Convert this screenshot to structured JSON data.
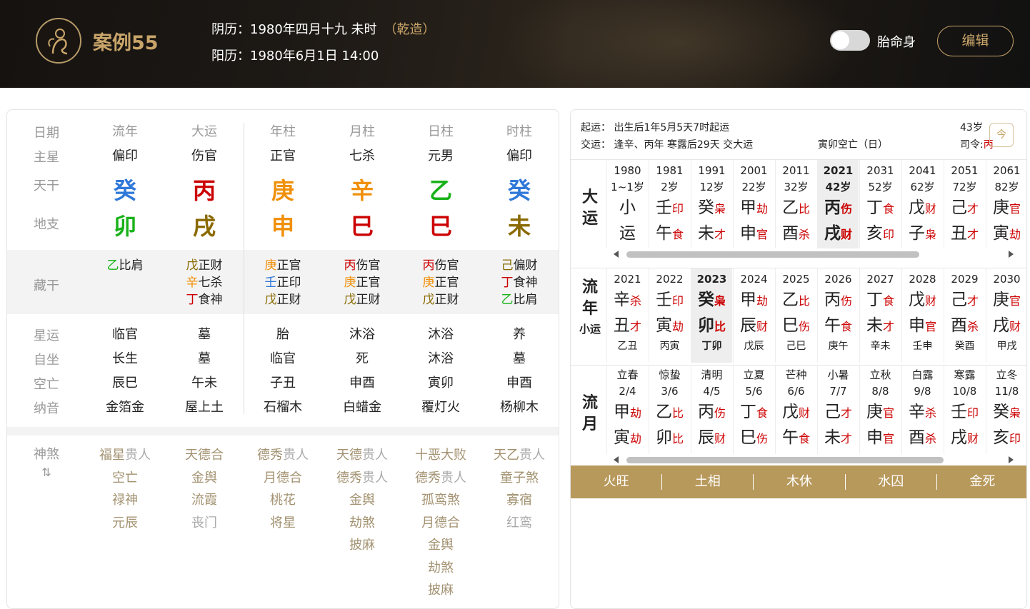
{
  "header": {
    "case_title": "案例55",
    "lunar_label": "阴历：1980年四月十九 未时",
    "lunar_tag": "（乾造）",
    "solar_label": "阳历：1980年6月1日 14:00",
    "toggle_label": "胎命身",
    "toggle_on": false,
    "edit_label": "编辑"
  },
  "colors": {
    "gold": "#c9a56a",
    "fire": "#cc0000",
    "wood": "#19b219",
    "water": "#2f78d9",
    "metal": "#f0900a",
    "earth": "#8a6a00"
  },
  "chart": {
    "row_labels": [
      "日期",
      "主星",
      "天干",
      "地支",
      "藏干",
      "星运",
      "自坐",
      "空亡",
      "纳音",
      "神煞"
    ],
    "shensha_toggle": "⇅",
    "columns": [
      {
        "header": "流年",
        "star": "偏印",
        "stem": "癸",
        "stem_color": "#2f78d9",
        "branch": "卯",
        "branch_color": "#19b219",
        "hidden": [
          {
            "s": "乙",
            "c": "#19b219",
            "g": "比肩"
          }
        ],
        "xingyun": "临官",
        "zizuo": "长生",
        "kongwang": "辰巳",
        "nayin": "金箔金",
        "shensha": [
          [
            "福星",
            "贵人"
          ],
          [
            "空亡",
            ""
          ],
          [
            "禄神",
            ""
          ],
          [
            "元辰",
            ""
          ]
        ]
      },
      {
        "header": "大运",
        "star": "伤官",
        "stem": "丙",
        "stem_color": "#cc0000",
        "branch": "戌",
        "branch_color": "#8a6a00",
        "hidden": [
          {
            "s": "戊",
            "c": "#8a6a00",
            "g": "正财"
          },
          {
            "s": "辛",
            "c": "#f0900a",
            "g": "七杀"
          },
          {
            "s": "丁",
            "c": "#cc0000",
            "g": "食神"
          }
        ],
        "xingyun": "墓",
        "zizuo": "墓",
        "kongwang": "午未",
        "nayin": "屋上土",
        "shensha": [
          [
            "天德合",
            ""
          ],
          [
            "金舆",
            ""
          ],
          [
            "流霞",
            ""
          ],
          [
            "",
            "丧门"
          ]
        ]
      },
      {
        "header": "年柱",
        "star": "正官",
        "stem": "庚",
        "stem_color": "#f0900a",
        "branch": "申",
        "branch_color": "#f0900a",
        "hidden": [
          {
            "s": "庚",
            "c": "#f0900a",
            "g": "正官"
          },
          {
            "s": "壬",
            "c": "#2f78d9",
            "g": "正印"
          },
          {
            "s": "戊",
            "c": "#8a6a00",
            "g": "正财"
          }
        ],
        "xingyun": "胎",
        "zizuo": "临官",
        "kongwang": "子丑",
        "nayin": "石榴木",
        "shensha": [
          [
            "德秀",
            "贵人"
          ],
          [
            "月德合",
            ""
          ],
          [
            "桃花",
            ""
          ],
          [
            "将星",
            ""
          ]
        ]
      },
      {
        "header": "月柱",
        "star": "七杀",
        "stem": "辛",
        "stem_color": "#f0900a",
        "branch": "巳",
        "branch_color": "#cc0000",
        "hidden": [
          {
            "s": "丙",
            "c": "#cc0000",
            "g": "伤官"
          },
          {
            "s": "庚",
            "c": "#f0900a",
            "g": "正官"
          },
          {
            "s": "戊",
            "c": "#8a6a00",
            "g": "正财"
          }
        ],
        "xingyun": "沐浴",
        "zizuo": "死",
        "kongwang": "申酉",
        "nayin": "白蜡金",
        "shensha": [
          [
            "天德",
            "贵人"
          ],
          [
            "德秀",
            "贵人"
          ],
          [
            "金舆",
            ""
          ],
          [
            "劫煞",
            ""
          ],
          [
            "披麻",
            ""
          ]
        ]
      },
      {
        "header": "日柱",
        "star": "元男",
        "stem": "乙",
        "stem_color": "#19b219",
        "branch": "巳",
        "branch_color": "#cc0000",
        "hidden": [
          {
            "s": "丙",
            "c": "#cc0000",
            "g": "伤官"
          },
          {
            "s": "庚",
            "c": "#f0900a",
            "g": "正官"
          },
          {
            "s": "戊",
            "c": "#8a6a00",
            "g": "正财"
          }
        ],
        "xingyun": "沐浴",
        "zizuo": "沐浴",
        "kongwang": "寅卯",
        "nayin": "覆灯火",
        "shensha": [
          [
            "十恶大败",
            ""
          ],
          [
            "德秀",
            "贵人"
          ],
          [
            "孤鸾煞",
            ""
          ],
          [
            "月德合",
            ""
          ],
          [
            "金舆",
            ""
          ],
          [
            "劫煞",
            ""
          ],
          [
            "披麻",
            ""
          ]
        ]
      },
      {
        "header": "时柱",
        "star": "偏印",
        "stem": "癸",
        "stem_color": "#2f78d9",
        "branch": "未",
        "branch_color": "#8a6a00",
        "hidden": [
          {
            "s": "己",
            "c": "#8a6a00",
            "g": "偏财"
          },
          {
            "s": "丁",
            "c": "#cc0000",
            "g": "食神"
          },
          {
            "s": "乙",
            "c": "#19b219",
            "g": "比肩"
          }
        ],
        "xingyun": "养",
        "zizuo": "墓",
        "kongwang": "申酉",
        "nayin": "杨柳木",
        "shensha": [
          [
            "天乙",
            "贵人"
          ],
          [
            "童子煞",
            ""
          ],
          [
            "寡宿",
            ""
          ],
          [
            "",
            "红鸾"
          ]
        ]
      }
    ]
  },
  "fortune": {
    "qiyun": "起运：  出生后1年5月5天7时起运",
    "jiaoyun": "交运：  逢辛、丙年 寒露后29天 交大运",
    "kongwang": "寅卯空亡（日）",
    "age": "43岁",
    "siling_label": "司令:",
    "siling_value": "丙",
    "today_icon": "今",
    "dayun_label": "大运",
    "dayun": [
      {
        "year": "1980",
        "age": "1~1岁",
        "stem": "小",
        "stem_god": "",
        "branch": "运",
        "branch_god": ""
      },
      {
        "year": "1981",
        "age": "2岁",
        "stem": "壬",
        "stem_god": "印",
        "branch": "午",
        "branch_god": "食"
      },
      {
        "year": "1991",
        "age": "12岁",
        "stem": "癸",
        "stem_god": "枭",
        "branch": "未",
        "branch_god": "才"
      },
      {
        "year": "2001",
        "age": "22岁",
        "stem": "甲",
        "stem_god": "劫",
        "branch": "申",
        "branch_god": "官"
      },
      {
        "year": "2011",
        "age": "32岁",
        "stem": "乙",
        "stem_god": "比",
        "branch": "酉",
        "branch_god": "杀"
      },
      {
        "year": "2021",
        "age": "42岁",
        "stem": "丙",
        "stem_god": "伤",
        "branch": "戌",
        "branch_god": "财",
        "current": true
      },
      {
        "year": "2031",
        "age": "52岁",
        "stem": "丁",
        "stem_god": "食",
        "branch": "亥",
        "branch_god": "印"
      },
      {
        "year": "2041",
        "age": "62岁",
        "stem": "戊",
        "stem_god": "财",
        "branch": "子",
        "branch_god": "枭"
      },
      {
        "year": "2051",
        "age": "72岁",
        "stem": "己",
        "stem_god": "才",
        "branch": "丑",
        "branch_god": "才"
      },
      {
        "year": "2061",
        "age": "82岁",
        "stem": "庚",
        "stem_god": "官",
        "branch": "寅",
        "branch_god": "劫"
      }
    ],
    "liunian_label_1": "流",
    "liunian_label_2": "年",
    "xiaoyun_label": "小运",
    "liunian": [
      {
        "year": "2021",
        "stem": "辛",
        "stem_god": "杀",
        "branch": "丑",
        "branch_god": "才",
        "xiaoyun": "乙丑"
      },
      {
        "year": "2022",
        "stem": "壬",
        "stem_god": "印",
        "branch": "寅",
        "branch_god": "劫",
        "xiaoyun": "丙寅"
      },
      {
        "year": "2023",
        "stem": "癸",
        "stem_god": "枭",
        "branch": "卯",
        "branch_god": "比",
        "xiaoyun": "丁卯",
        "current": true
      },
      {
        "year": "2024",
        "stem": "甲",
        "stem_god": "劫",
        "branch": "辰",
        "branch_god": "财",
        "xiaoyun": "戊辰"
      },
      {
        "year": "2025",
        "stem": "乙",
        "stem_god": "比",
        "branch": "巳",
        "branch_god": "伤",
        "xiaoyun": "己巳"
      },
      {
        "year": "2026",
        "stem": "丙",
        "stem_god": "伤",
        "branch": "午",
        "branch_god": "食",
        "xiaoyun": "庚午"
      },
      {
        "year": "2027",
        "stem": "丁",
        "stem_god": "食",
        "branch": "未",
        "branch_god": "才",
        "xiaoyun": "辛未"
      },
      {
        "year": "2028",
        "stem": "戊",
        "stem_god": "财",
        "branch": "申",
        "branch_god": "官",
        "xiaoyun": "壬申"
      },
      {
        "year": "2029",
        "stem": "己",
        "stem_god": "才",
        "branch": "酉",
        "branch_god": "杀",
        "xiaoyun": "癸酉"
      },
      {
        "year": "2030",
        "stem": "庚",
        "stem_god": "官",
        "branch": "戌",
        "branch_god": "财",
        "xiaoyun": "甲戌"
      }
    ],
    "liuyue_label": "流月",
    "liuyue": [
      {
        "term": "立春",
        "date": "2/4",
        "stem": "甲",
        "stem_god": "劫",
        "branch": "寅",
        "branch_god": "劫"
      },
      {
        "term": "惊蛰",
        "date": "3/6",
        "stem": "乙",
        "stem_god": "比",
        "branch": "卯",
        "branch_god": "比"
      },
      {
        "term": "清明",
        "date": "4/5",
        "stem": "丙",
        "stem_god": "伤",
        "branch": "辰",
        "branch_god": "财"
      },
      {
        "term": "立夏",
        "date": "5/6",
        "stem": "丁",
        "stem_god": "食",
        "branch": "巳",
        "branch_god": "伤"
      },
      {
        "term": "芒种",
        "date": "6/6",
        "stem": "戊",
        "stem_god": "财",
        "branch": "午",
        "branch_god": "食"
      },
      {
        "term": "小暑",
        "date": "7/7",
        "stem": "己",
        "stem_god": "才",
        "branch": "未",
        "branch_god": "才"
      },
      {
        "term": "立秋",
        "date": "8/8",
        "stem": "庚",
        "stem_god": "官",
        "branch": "申",
        "branch_god": "官"
      },
      {
        "term": "白露",
        "date": "9/8",
        "stem": "辛",
        "stem_god": "杀",
        "branch": "酉",
        "branch_god": "杀"
      },
      {
        "term": "寒露",
        "date": "10/8",
        "stem": "壬",
        "stem_god": "印",
        "branch": "戌",
        "branch_god": "财"
      },
      {
        "term": "立冬",
        "date": "11/8",
        "stem": "癸",
        "stem_god": "枭",
        "branch": "亥",
        "branch_god": "印"
      }
    ],
    "wangshuai": [
      "火旺",
      "土相",
      "木休",
      "水囚",
      "金死"
    ]
  }
}
